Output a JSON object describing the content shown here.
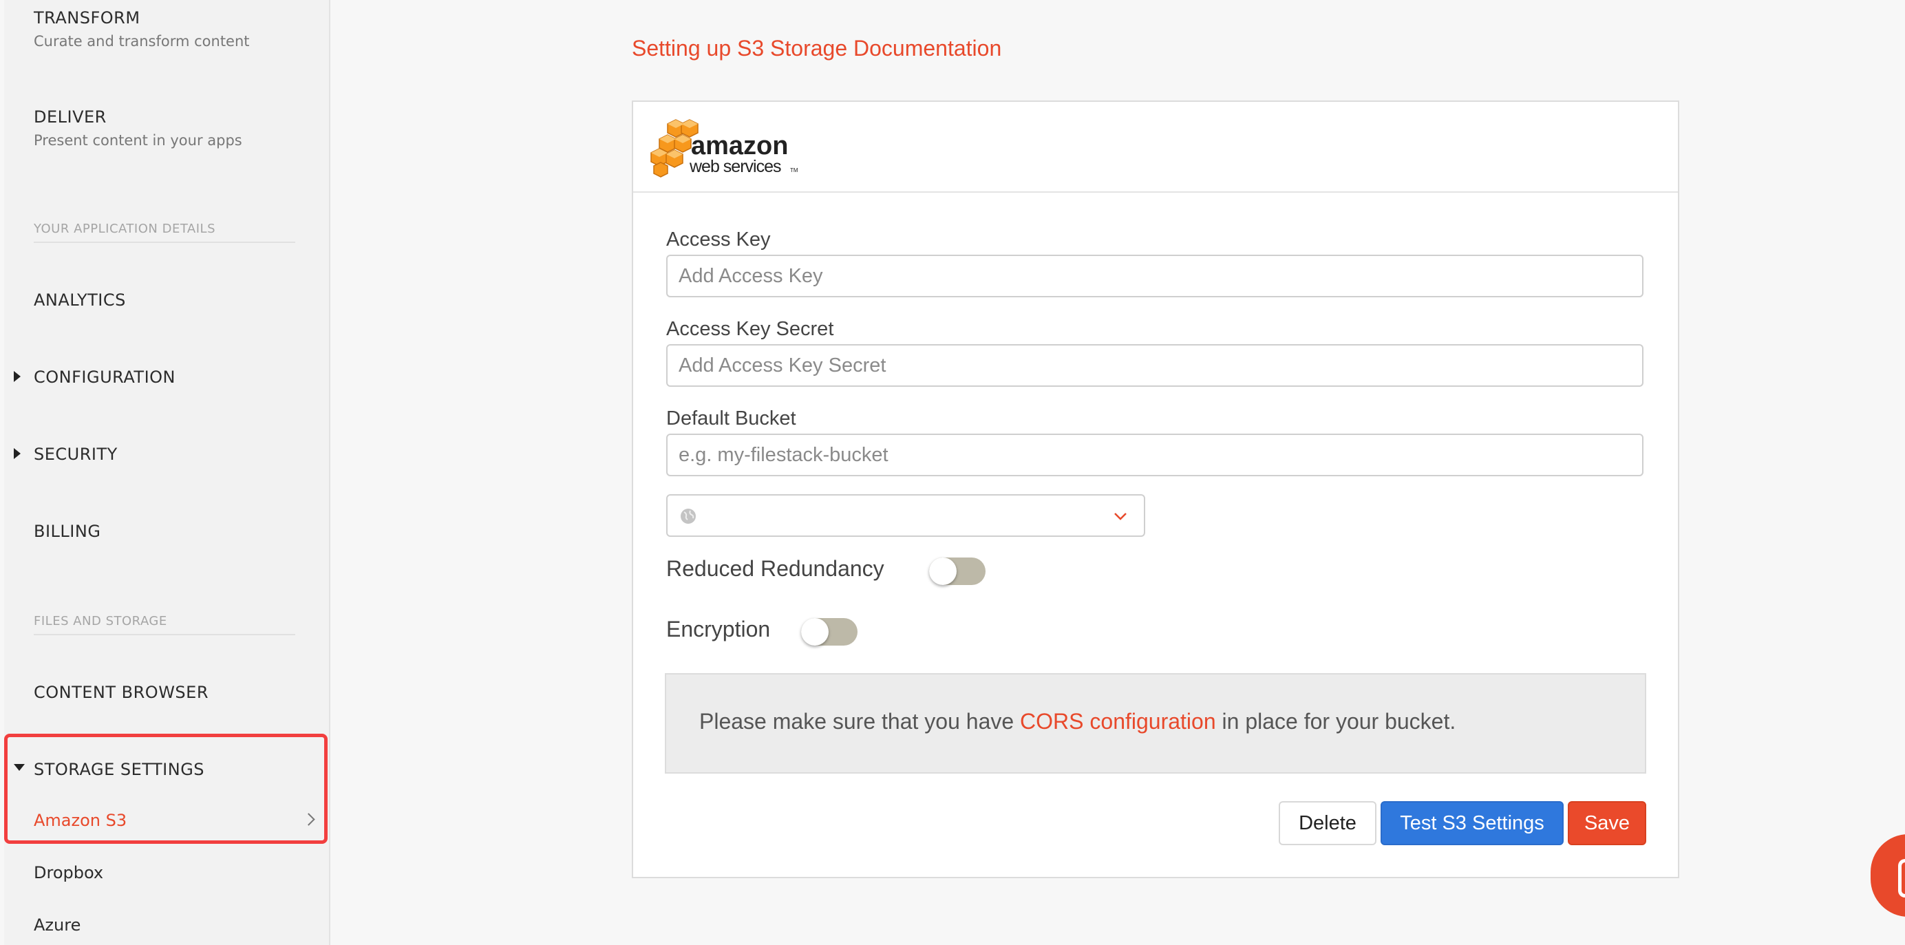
{
  "sidebar": {
    "transform_title": "TRANSFORM",
    "transform_sub": "Curate and transform content",
    "deliver_title": "DELIVER",
    "deliver_sub": "Present content in your apps",
    "section_app_details": "YOUR APPLICATION DETAILS",
    "analytics": "ANALYTICS",
    "configuration": "CONFIGURATION",
    "security": "SECURITY",
    "billing": "BILLING",
    "section_files_storage": "FILES AND STORAGE",
    "content_browser": "CONTENT BROWSER",
    "storage_settings": "STORAGE SETTINGS",
    "storage_items": [
      "Amazon S3",
      "Dropbox",
      "Azure"
    ]
  },
  "main": {
    "doc_link": "Setting up S3 Storage Documentation",
    "logo": {
      "word1": "amazon",
      "word2": "web services",
      "tm": "TM"
    },
    "access_key": {
      "label": "Access Key",
      "placeholder": "Add Access Key",
      "value": ""
    },
    "access_key_secret": {
      "label": "Access Key Secret",
      "placeholder": "Add Access Key Secret",
      "value": ""
    },
    "default_bucket": {
      "label": "Default Bucket",
      "placeholder": "e.g. my-filestack-bucket",
      "value": ""
    },
    "region_select": {
      "value": "",
      "icon": "globe-icon"
    },
    "reduced_redundancy": {
      "label": "Reduced Redundancy",
      "enabled": false
    },
    "encryption": {
      "label": "Encryption",
      "enabled": false
    },
    "notice": {
      "before": "Please make sure that you have ",
      "link": "CORS configuration",
      "after": " in place for your bucket."
    },
    "buttons": {
      "delete": "Delete",
      "test": "Test S3 Settings",
      "save": "Save"
    }
  },
  "colors": {
    "accent": "#e8492b",
    "primary_blue": "#2f78dd",
    "highlight_border": "#f23f3f",
    "toggle_off": "#bdb9a8"
  }
}
